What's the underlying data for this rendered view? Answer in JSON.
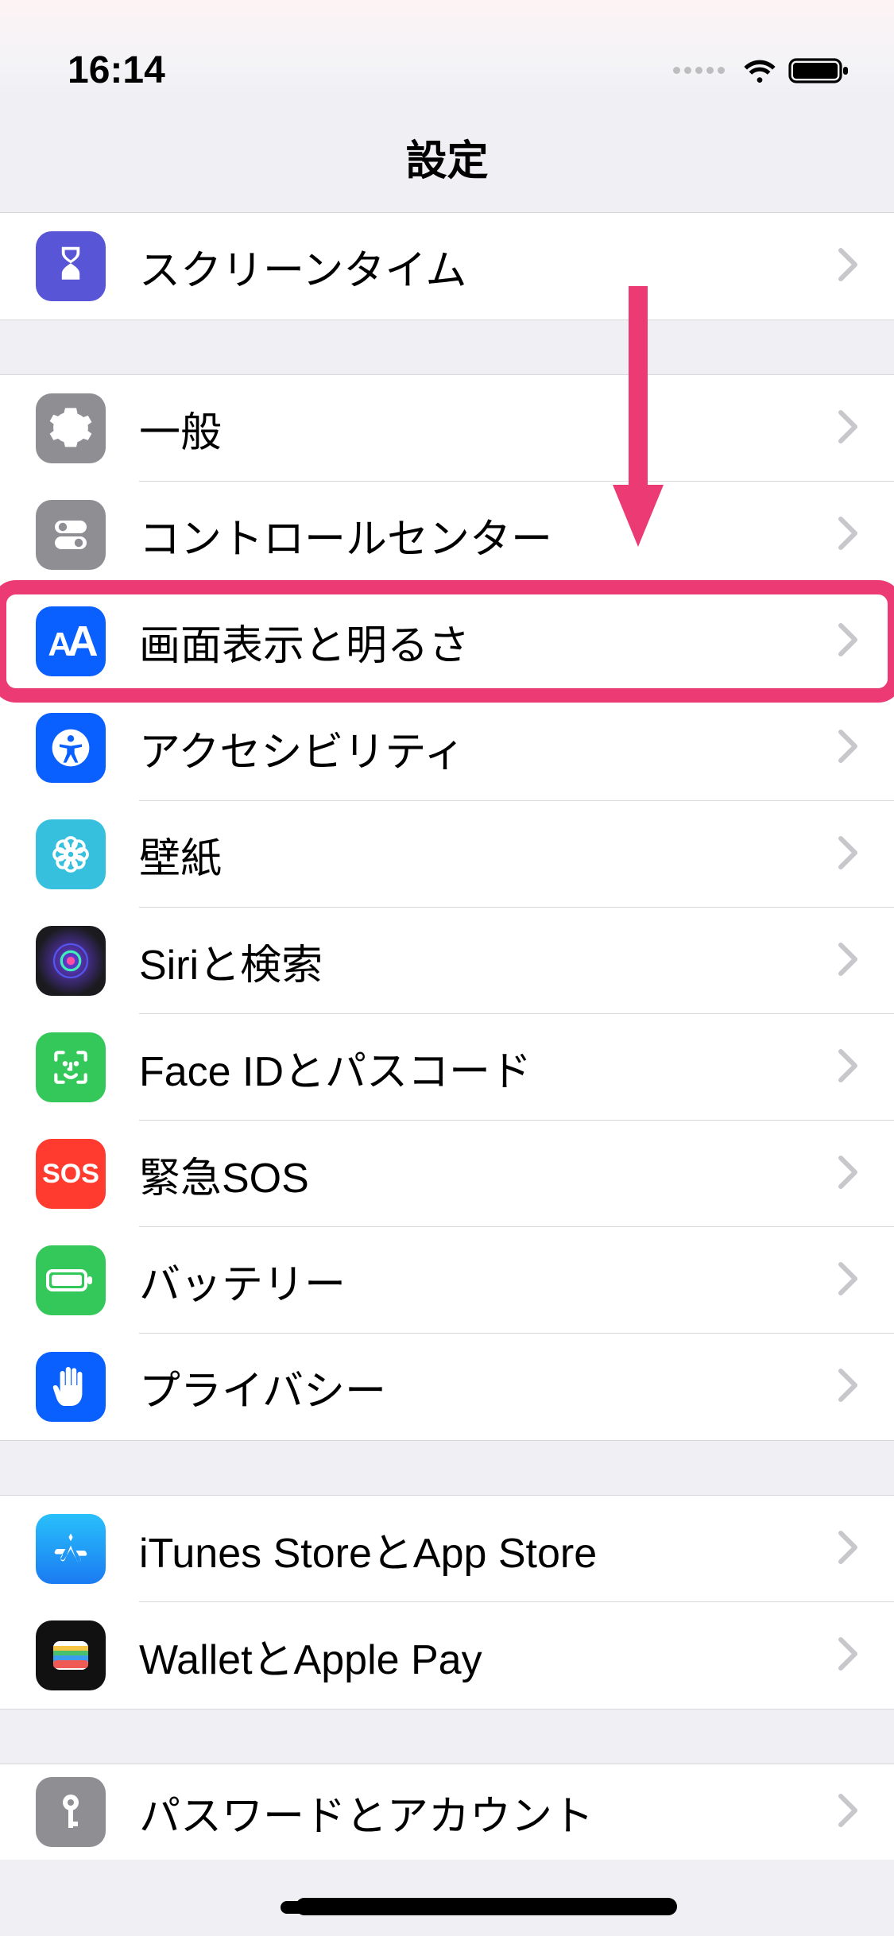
{
  "status": {
    "time": "16:14"
  },
  "title": "設定",
  "groups": [
    {
      "items": [
        {
          "key": "screen-time",
          "label": "スクリーンタイム",
          "iconName": "hourglass-icon",
          "iconBg": "#5856d6"
        }
      ]
    },
    {
      "items": [
        {
          "key": "general",
          "label": "一般",
          "iconName": "gear-icon",
          "iconBg": "#8e8e93"
        },
        {
          "key": "control-center",
          "label": "コントロールセンター",
          "iconName": "toggles-icon",
          "iconBg": "#8e8e93"
        },
        {
          "key": "display-brightness",
          "label": "画面表示と明るさ",
          "iconName": "text-size-icon",
          "iconBg": "#0a60ff",
          "highlighted": true
        },
        {
          "key": "accessibility",
          "label": "アクセシビリティ",
          "iconName": "accessibility-icon",
          "iconBg": "#0a60ff"
        },
        {
          "key": "wallpaper",
          "label": "壁紙",
          "iconName": "flower-icon",
          "iconBg": "#37c0de"
        },
        {
          "key": "siri-search",
          "label": "Siriと検索",
          "iconName": "siri-icon",
          "iconBg": "#1b1b1f"
        },
        {
          "key": "faceid-passcode",
          "label": "Face IDとパスコード",
          "iconName": "faceid-icon",
          "iconBg": "#34c759"
        },
        {
          "key": "emergency-sos",
          "label": "緊急SOS",
          "iconName": "sos-icon",
          "iconBg": "#ff3b30",
          "iconText": "SOS"
        },
        {
          "key": "battery",
          "label": "バッテリー",
          "iconName": "battery-icon",
          "iconBg": "#34c759"
        },
        {
          "key": "privacy",
          "label": "プライバシー",
          "iconName": "hand-icon",
          "iconBg": "#0a60ff"
        }
      ]
    },
    {
      "items": [
        {
          "key": "itunes-appstore",
          "label": "iTunes StoreとApp Store",
          "iconName": "appstore-icon",
          "iconBg": "#1f9bf0"
        },
        {
          "key": "wallet-applepay",
          "label": "WalletとApple Pay",
          "iconName": "wallet-icon",
          "iconBg": "#111111"
        }
      ]
    },
    {
      "items": [
        {
          "key": "passwords-accounts",
          "label": "パスワードとアカウント",
          "iconName": "key-icon",
          "iconBg": "#8e8e93"
        }
      ]
    }
  ],
  "annotations": {
    "highlightedRowKey": "display-brightness",
    "arrowColor": "#eb3a74"
  }
}
